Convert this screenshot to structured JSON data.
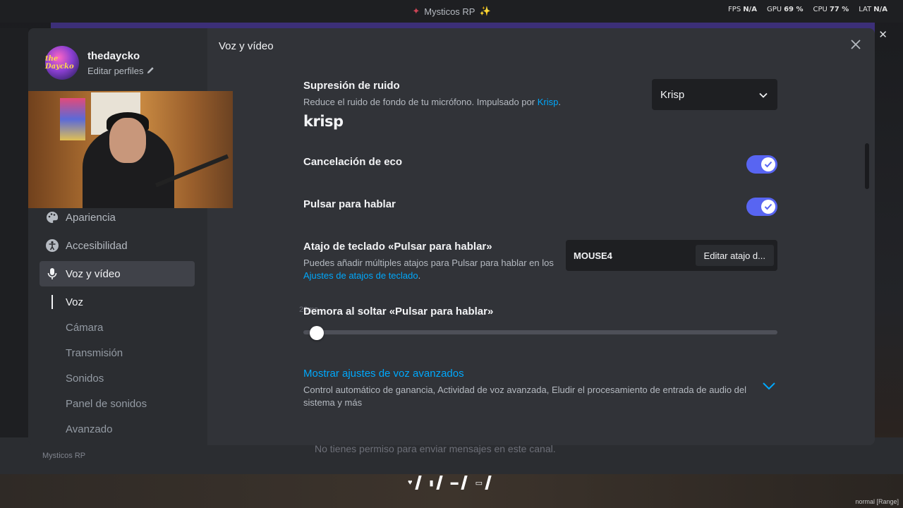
{
  "window": {
    "title": "Mysticos RP",
    "stats": [
      {
        "label": "FPS",
        "value": "N/A"
      },
      {
        "label": "GPU",
        "value": "69 %"
      },
      {
        "label": "CPU",
        "value": "77 %"
      },
      {
        "label": "LAT",
        "value": "N/A"
      }
    ]
  },
  "background": {
    "status_server": "Mysticos RP",
    "message_placeholder": "No tienes permiso para enviar mensajes en este canal.",
    "mode_label": "normal [Range]"
  },
  "profile": {
    "username": "thedaycko",
    "edit_label": "Editar perfiles",
    "avatar_text": "the Daycko"
  },
  "sidebar": {
    "items": [
      {
        "label": "Apariencia",
        "icon": "palette-icon"
      },
      {
        "label": "Accesibilidad",
        "icon": "accessibility-icon"
      },
      {
        "label": "Voz y vídeo",
        "icon": "microphone-icon",
        "active": true
      }
    ],
    "sub_items": [
      {
        "label": "Voz",
        "active": true
      },
      {
        "label": "Cámara"
      },
      {
        "label": "Transmisión"
      },
      {
        "label": "Sonidos"
      },
      {
        "label": "Panel de sonidos"
      },
      {
        "label": "Avanzado"
      }
    ]
  },
  "content": {
    "title": "Voz y vídeo",
    "noise": {
      "title": "Supresión de ruido",
      "desc": "Reduce el ruido de fondo de tu micrófono. Impulsado por",
      "desc_link": "Krisp",
      "desc_end": ".",
      "selected": "Krisp",
      "logo": "krisp"
    },
    "echo": {
      "title": "Cancelación de eco",
      "enabled": true
    },
    "ptt": {
      "title": "Pulsar para hablar",
      "enabled": true
    },
    "keybind": {
      "title": "Atajo de teclado «Pulsar para hablar»",
      "desc": "Puedes añadir múltiples atajos para Pulsar para hablar en los",
      "desc_link": "Ajustes de atajos de teclado",
      "desc_end": ".",
      "value": "MOUSE4",
      "edit_label": "Editar atajo d..."
    },
    "delay": {
      "title": "Demora al soltar «Pulsar para hablar»",
      "value_label": "20ms",
      "value": 0.02
    },
    "advanced": {
      "title": "Mostrar ajustes de voz avanzados",
      "desc": "Control automático de ganancia, Actividad de voz avanzada, Eludir el procesamiento de entrada de audio del sistema y más"
    }
  },
  "colors": {
    "accent": "#5865f2",
    "link": "#00a8fc",
    "bg_modal": "#313338",
    "bg_sidebar": "#2b2d31"
  }
}
